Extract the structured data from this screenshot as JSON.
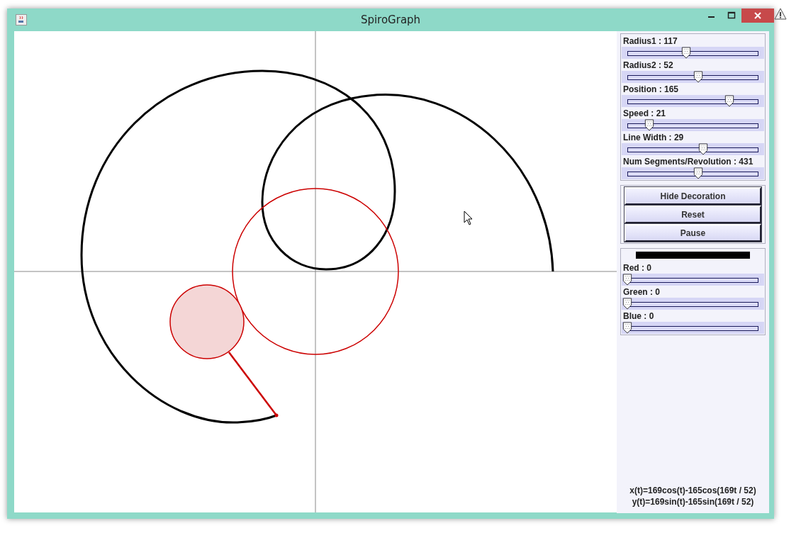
{
  "window": {
    "title": "SpiroGraph"
  },
  "sliders": [
    {
      "label": "Radius1 : 117",
      "level": 0.45
    },
    {
      "label": "Radius2 : 52",
      "level": 0.54
    },
    {
      "label": "Position : 165",
      "level": 0.78
    },
    {
      "label": "Speed : 21",
      "level": 0.17
    },
    {
      "label": "Line Width : 29",
      "level": 0.58
    },
    {
      "label": "Num Segments/Revolution : 431",
      "level": 0.54
    }
  ],
  "buttons": [
    "Hide Decoration",
    "Reset",
    "Pause"
  ],
  "color_sliders": [
    {
      "label": "Red : 0",
      "level": 0
    },
    {
      "label": "Green : 0",
      "level": 0
    },
    {
      "label": "Blue : 0",
      "level": 0
    }
  ],
  "equations": [
    "x(t)=169cos(t)-165cos(169t / 52)",
    "y(t)=169sin(t)-165sin(169t / 52)"
  ]
}
